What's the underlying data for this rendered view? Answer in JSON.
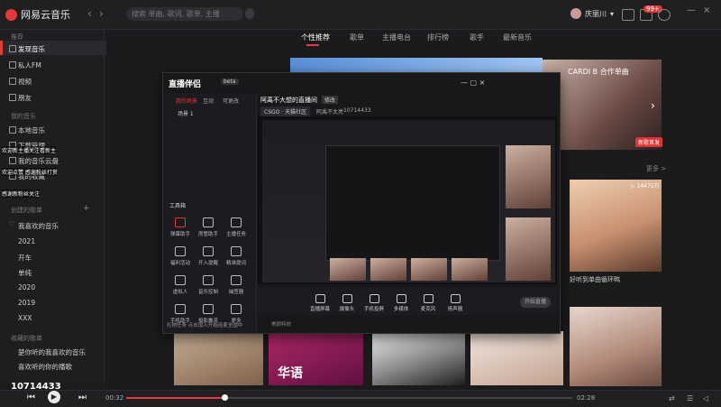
{
  "app": {
    "title": "网易云音乐"
  },
  "header": {
    "search_placeholder": "搜索 单曲, 歌词, 歌单, 主播",
    "username": "庆丽川",
    "notif_badge": "99+"
  },
  "tabs": [
    "个性推荐",
    "歌单",
    "主播电台",
    "排行榜",
    "歌手",
    "最新音乐"
  ],
  "sidebar": {
    "sections": [
      {
        "title": "推荐",
        "items": [
          "发现音乐",
          "私人FM",
          "视频",
          "朋友"
        ]
      },
      {
        "title": "我的音乐",
        "items": [
          "本地音乐",
          "下载管理",
          "我的音乐云盘",
          "我的收藏"
        ]
      },
      {
        "title": "创建的歌单",
        "items": [
          "我喜欢的音乐",
          "2021",
          "开车",
          "单纯",
          "2020",
          "2019",
          "XXX"
        ]
      },
      {
        "title": "收藏的歌单",
        "items": [
          "楚你听的我喜欢的音乐",
          "喜欢听的你的播歌"
        ]
      }
    ]
  },
  "content": {
    "banner_text": "CARDI B 合作单曲",
    "banner_tag": "新歌首发",
    "more_label": "更多 >",
    "cover1_plays": "▷ 14475万",
    "cover1_title": "好听到单曲循环鸭",
    "cover_b2_text": "华语"
  },
  "overlay": {
    "app_title": "直播伴侣",
    "version": "beta",
    "tabs": [
      "我的场景",
      "互动",
      "可更改"
    ],
    "scene": "场景 1",
    "tools_label": "工具箱",
    "tools": [
      "弹幕助手",
      "房管助手",
      "主播任务",
      "福利活动",
      "开入提醒",
      "精准提词",
      "虚拟人",
      "音乐控制",
      "抽签器",
      "手机助手",
      "投影推流",
      "更多"
    ],
    "room_title": "阿禹不大想的直播间",
    "room_tag": "修改",
    "game": "CSGO · 天猫社区",
    "host": "阿禹不太亮",
    "room_count": "10714433",
    "bottom_tools": [
      "直播屏幕",
      "摄像头",
      "手机投屏",
      "多媒体",
      "麦克风",
      "扬声器"
    ],
    "start_label": "开始直播",
    "footer": "礼物任务  点击加入开始连麦全国中",
    "statusbar": "美颜特效"
  },
  "stream_overlay": {
    "fan_line1": "欢迎新主播关注看新主",
    "fan_line2": "欢迎点赞 感谢粉丝打赏",
    "fan_line3": "感谢新粉丝关注",
    "room_id": "10714433"
  },
  "player": {
    "current_time": "00:32",
    "duration": "02:28",
    "progress": 0.22
  },
  "colors": {
    "accent": "#e33a3a",
    "bg": "#1b1b1d"
  }
}
